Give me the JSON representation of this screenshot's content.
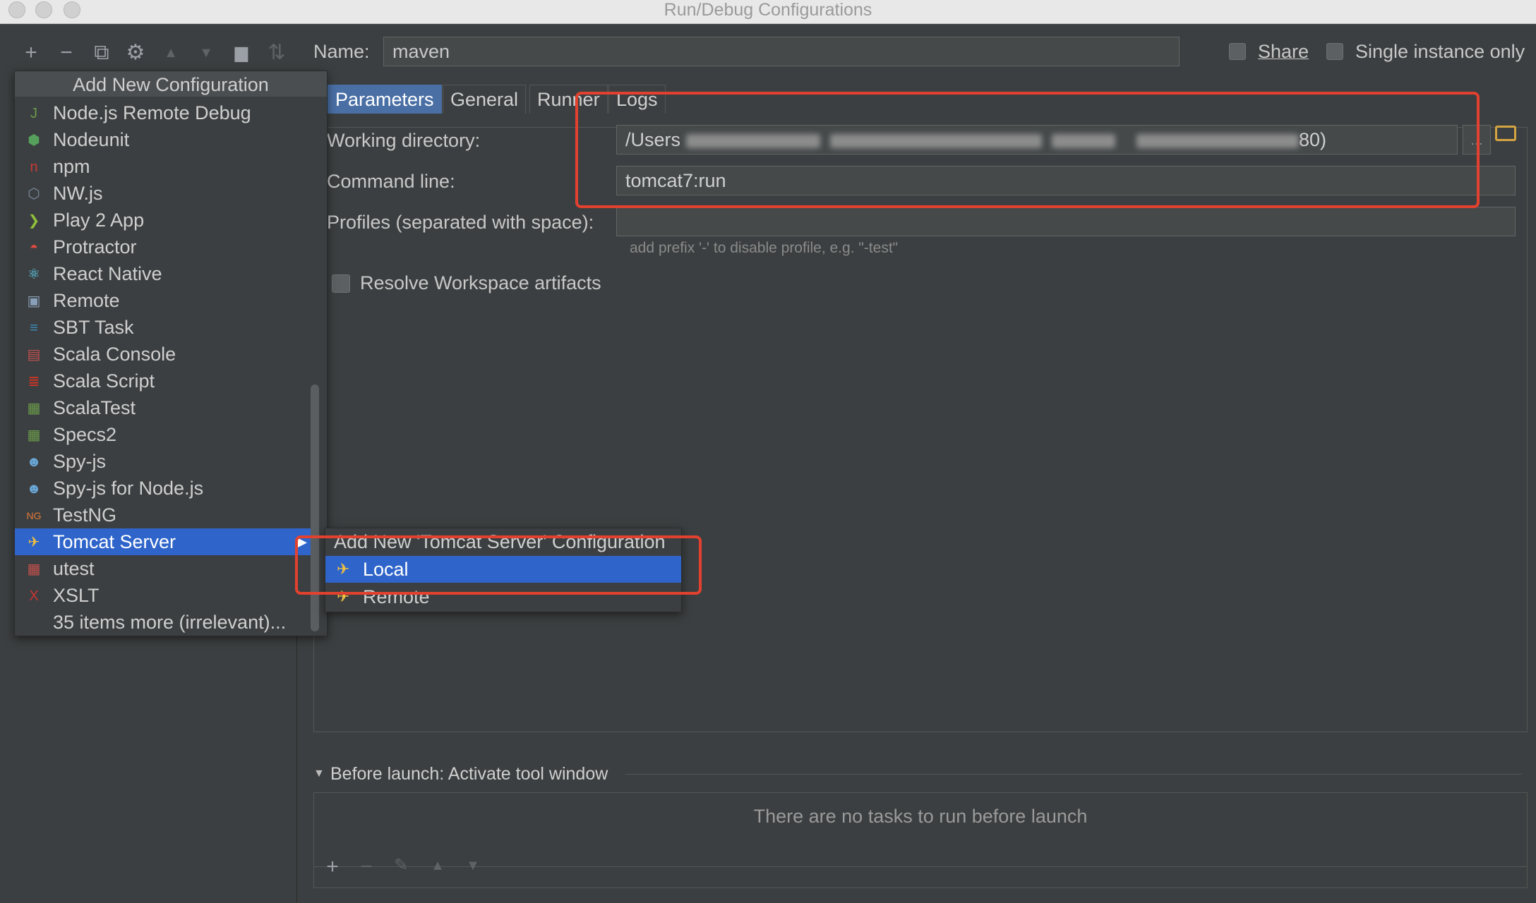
{
  "window": {
    "title": "Run/Debug Configurations"
  },
  "toolbar": {
    "add": "+",
    "remove": "−",
    "copy": "⧉",
    "edit_defaults": "⚙",
    "move_up": "▲",
    "move_down": "▼",
    "folder": "▆",
    "sort": "⇅"
  },
  "name_row": {
    "label": "Name:",
    "value": "maven",
    "share_label": "Share",
    "single_instance_label": "Single instance only"
  },
  "popup": {
    "header": "Add New Configuration",
    "items": [
      {
        "label": "Node.js Remote Debug",
        "icon": "nodejs-icon",
        "glyph": "J",
        "color": "#6b9a4a"
      },
      {
        "label": "Nodeunit",
        "icon": "nodeunit-icon",
        "glyph": "⬢",
        "color": "#55a05a"
      },
      {
        "label": "npm",
        "icon": "npm-icon",
        "glyph": "n",
        "color": "#cb3837"
      },
      {
        "label": "NW.js",
        "icon": "nwjs-icon",
        "glyph": "⬡",
        "color": "#7a8aa0"
      },
      {
        "label": "Play 2 App",
        "icon": "play-icon",
        "glyph": "❯",
        "color": "#8fbe3a"
      },
      {
        "label": "Protractor",
        "icon": "protractor-icon",
        "glyph": "◓",
        "color": "#e04a3f"
      },
      {
        "label": "React Native",
        "icon": "react-icon",
        "glyph": "⚛",
        "color": "#61dafb"
      },
      {
        "label": "Remote",
        "icon": "remote-icon",
        "glyph": "▣",
        "color": "#8aa0b8"
      },
      {
        "label": "SBT Task",
        "icon": "sbt-icon",
        "glyph": "≡",
        "color": "#3c8dbc"
      },
      {
        "label": "Scala Console",
        "icon": "scala-console-icon",
        "glyph": "▤",
        "color": "#c0504d"
      },
      {
        "label": "Scala Script",
        "icon": "scala-script-icon",
        "glyph": "≣",
        "color": "#de3423"
      },
      {
        "label": "ScalaTest",
        "icon": "scalatest-icon",
        "glyph": "▦",
        "color": "#6a9a4a"
      },
      {
        "label": "Specs2",
        "icon": "specs2-icon",
        "glyph": "▦",
        "color": "#6a9a4a"
      },
      {
        "label": "Spy-js",
        "icon": "spyjs-icon",
        "glyph": "☻",
        "color": "#6aa8d8"
      },
      {
        "label": "Spy-js for Node.js",
        "icon": "spyjs-node-icon",
        "glyph": "☻",
        "color": "#6aa8d8"
      },
      {
        "label": "TestNG",
        "icon": "testng-icon",
        "glyph": "NG",
        "color": "#e07a3a"
      },
      {
        "label": "Tomcat Server",
        "icon": "tomcat-icon",
        "glyph": "✈",
        "color": "#f0c040"
      },
      {
        "label": "utest",
        "icon": "utest-icon",
        "glyph": "▦",
        "color": "#c0504d"
      },
      {
        "label": "XSLT",
        "icon": "xslt-icon",
        "glyph": "X",
        "color": "#cc3333"
      },
      {
        "label": "35 items more (irrelevant)...",
        "icon": "",
        "glyph": "",
        "color": ""
      }
    ],
    "submenu_arrow": "▶"
  },
  "submenu": {
    "header": "Add New 'Tomcat Server' Configuration",
    "items": [
      {
        "label": "Local",
        "icon": "tomcat-local-icon"
      },
      {
        "label": "Remote",
        "icon": "tomcat-remote-icon"
      }
    ]
  },
  "tabs": [
    "Parameters",
    "General",
    "Runner",
    "Logs"
  ],
  "form": {
    "working_dir_label": "Working directory:",
    "working_dir_prefix": "/Users",
    "working_dir_suffix": "80)",
    "command_line_label": "Command line:",
    "command_line_value": "tomcat7:run",
    "profiles_label": "Profiles (separated with space):",
    "profiles_value": "",
    "profiles_hint": "add prefix '-' to disable profile, e.g. \"-test\"",
    "resolve_label": "Resolve Workspace artifacts"
  },
  "before_launch": {
    "label": "Before launch: Activate tool window",
    "empty_text": "There are no tasks to run before launch"
  }
}
